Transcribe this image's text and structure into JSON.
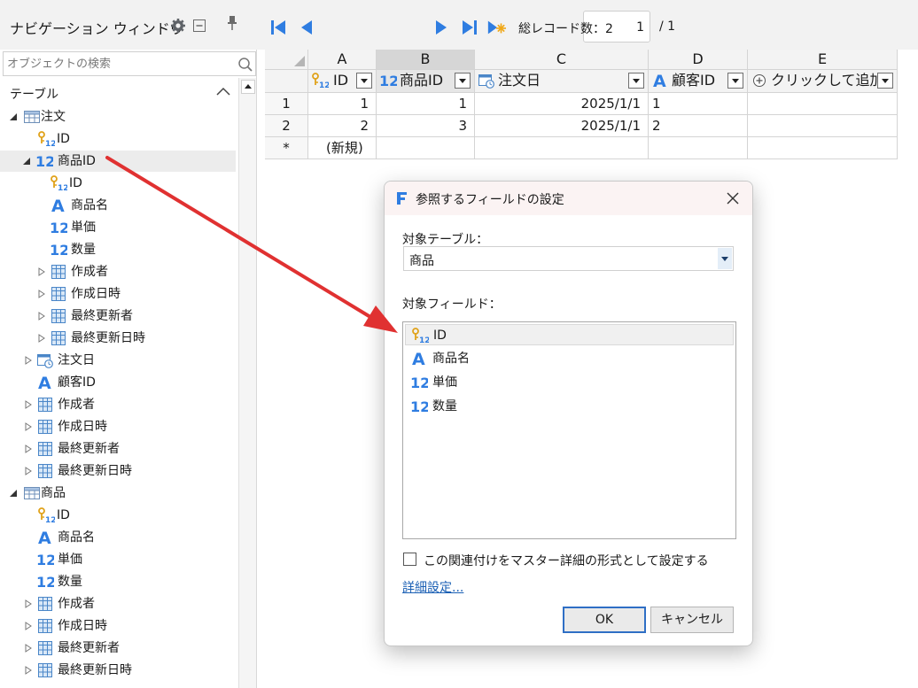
{
  "nav": {
    "title": "ナビゲーション ウィンドウ",
    "search_placeholder": "オブジェクトの検索",
    "tables_header": "テーブル",
    "tree": [
      {
        "label": "注文",
        "icon": "table-icon",
        "twisty": "expanded"
      },
      {
        "label": "ID",
        "icon": "key-number-icon",
        "twisty": "none"
      },
      {
        "label": "商品ID",
        "icon": "number-icon",
        "twisty": "expanded",
        "selected": true
      },
      {
        "label": "ID",
        "icon": "key-number-icon",
        "twisty": "none"
      },
      {
        "label": "商品名",
        "icon": "text-icon",
        "twisty": "none"
      },
      {
        "label": "単価",
        "icon": "number-icon",
        "twisty": "none"
      },
      {
        "label": "数量",
        "icon": "number-icon",
        "twisty": "none"
      },
      {
        "label": "作成者",
        "icon": "grid-icon",
        "twisty": "collapsed"
      },
      {
        "label": "作成日時",
        "icon": "grid-icon",
        "twisty": "collapsed"
      },
      {
        "label": "最終更新者",
        "icon": "grid-icon",
        "twisty": "collapsed"
      },
      {
        "label": "最終更新日時",
        "icon": "grid-icon",
        "twisty": "collapsed"
      },
      {
        "label": "注文日",
        "icon": "date-icon",
        "twisty": "collapsed"
      },
      {
        "label": "顧客ID",
        "icon": "text-icon",
        "twisty": "none"
      },
      {
        "label": "作成者",
        "icon": "grid-icon",
        "twisty": "collapsed"
      },
      {
        "label": "作成日時",
        "icon": "grid-icon",
        "twisty": "collapsed"
      },
      {
        "label": "最終更新者",
        "icon": "grid-icon",
        "twisty": "collapsed"
      },
      {
        "label": "最終更新日時",
        "icon": "grid-icon",
        "twisty": "collapsed"
      },
      {
        "label": "商品",
        "icon": "table-icon",
        "twisty": "expanded"
      },
      {
        "label": "ID",
        "icon": "key-number-icon",
        "twisty": "none"
      },
      {
        "label": "商品名",
        "icon": "text-icon",
        "twisty": "none"
      },
      {
        "label": "単価",
        "icon": "number-icon",
        "twisty": "none"
      },
      {
        "label": "数量",
        "icon": "number-icon",
        "twisty": "none"
      },
      {
        "label": "作成者",
        "icon": "grid-icon",
        "twisty": "collapsed"
      },
      {
        "label": "作成日時",
        "icon": "grid-icon",
        "twisty": "collapsed"
      },
      {
        "label": "最終更新者",
        "icon": "grid-icon",
        "twisty": "collapsed"
      },
      {
        "label": "最終更新日時",
        "icon": "grid-icon",
        "twisty": "collapsed"
      }
    ]
  },
  "toolbar": {
    "current_record": "1",
    "record_total": "/ 1",
    "total_records_label": "総レコード数：2"
  },
  "grid": {
    "columns": [
      {
        "letter": "A",
        "field": "ID",
        "icon": "key-number-icon"
      },
      {
        "letter": "B",
        "field": "商品ID",
        "icon": "number-icon",
        "selected": true
      },
      {
        "letter": "C",
        "field": "注文日",
        "icon": "date-icon"
      },
      {
        "letter": "D",
        "field": "顧客ID",
        "icon": "text-icon"
      },
      {
        "letter": "E",
        "field": "クリックして追加",
        "icon": "add-icon"
      }
    ],
    "rows": [
      {
        "num": "1",
        "cells": [
          "1",
          "1",
          "2025/1/1",
          "1",
          ""
        ]
      },
      {
        "num": "2",
        "cells": [
          "2",
          "3",
          "2025/1/1",
          "2",
          ""
        ]
      },
      {
        "num": "*",
        "cells": [
          "(新規)",
          "",
          "",
          "",
          ""
        ]
      }
    ]
  },
  "dialog": {
    "title": "参照するフィールドの設定",
    "target_table_label": "対象テーブル：",
    "target_table_value": "商品",
    "target_field_label": "対象フィールド：",
    "fields": [
      {
        "label": "ID",
        "icon": "key-number-icon",
        "selected": true
      },
      {
        "label": "商品名",
        "icon": "text-icon"
      },
      {
        "label": "単価",
        "icon": "number-icon"
      },
      {
        "label": "数量",
        "icon": "number-icon"
      }
    ],
    "master_detail_label": "この関連付けをマスター詳細の形式として設定する",
    "master_detail_checked": false,
    "advanced_link": "詳細設定...",
    "ok_label": "OK",
    "cancel_label": "キャンセル"
  },
  "colors": {
    "accent_blue": "#2f7de1",
    "arrow_red": "#e03131"
  }
}
